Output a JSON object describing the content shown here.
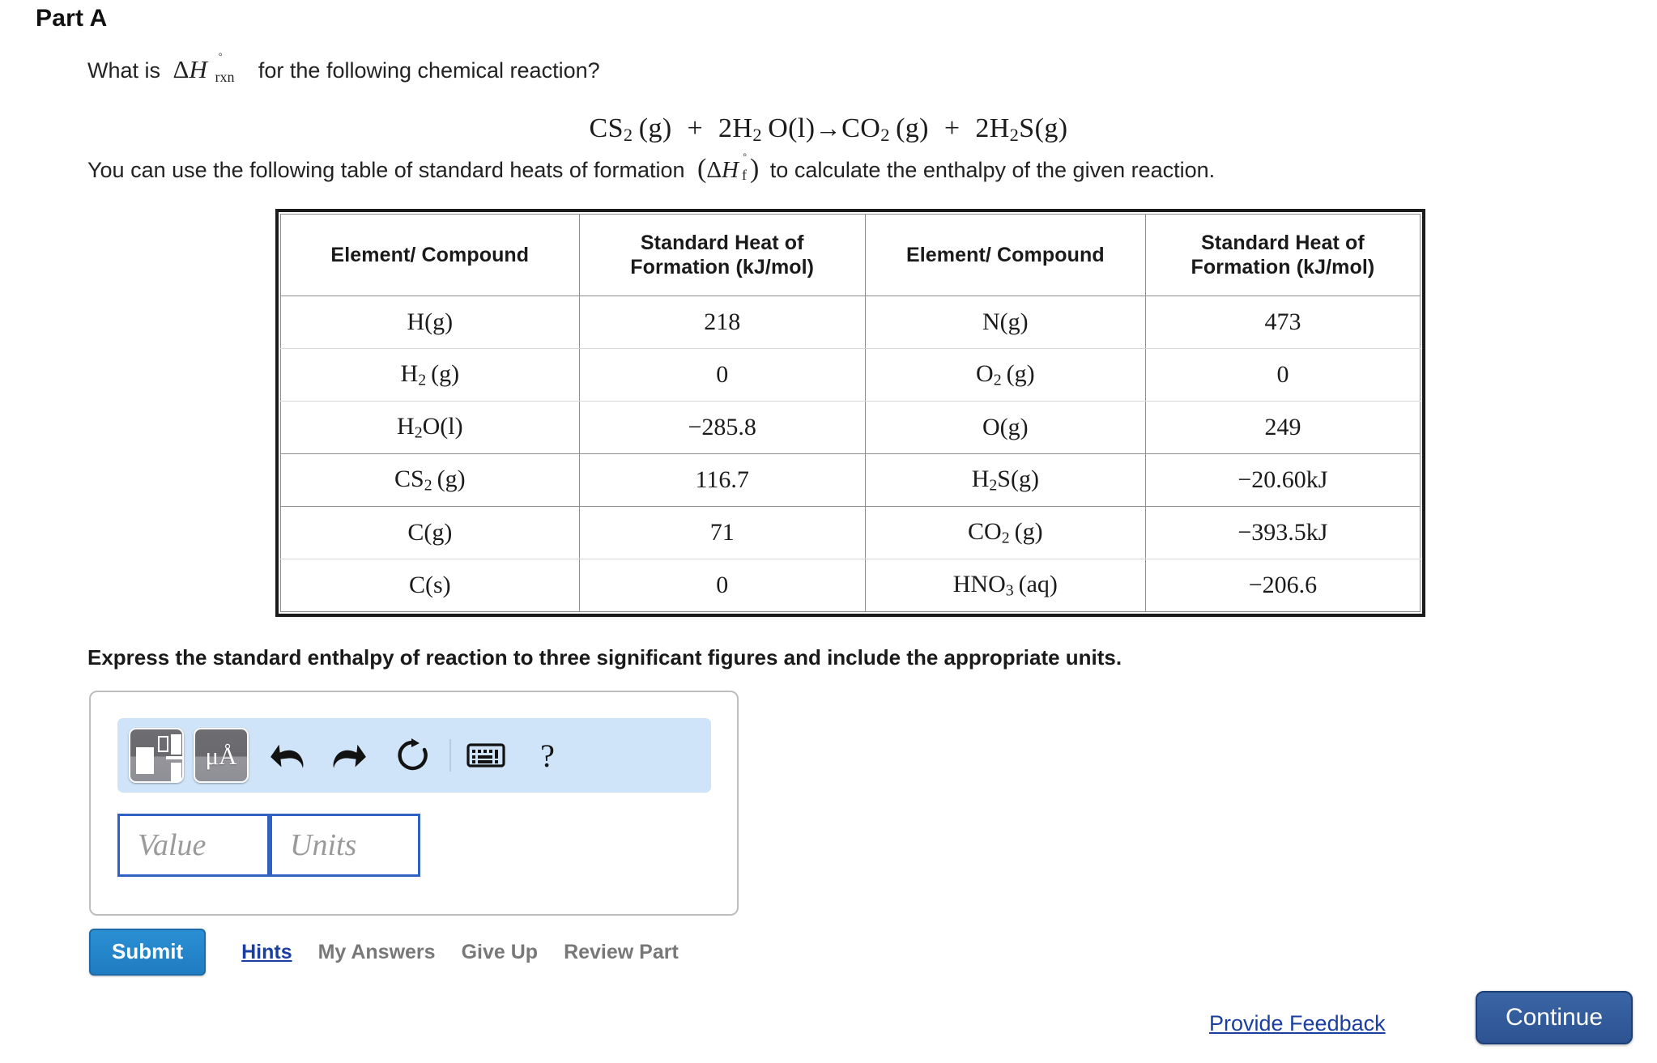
{
  "part": {
    "heading": "Part A"
  },
  "question": {
    "prefix": "What is",
    "symbol_delta": "Δ",
    "symbol_h": "H",
    "symbol_degree": "◦",
    "symbol_sub": "rxn",
    "suffix": "for the following chemical reaction?",
    "equation": "CS2 (g) + 2H2 O(l)→CO2 (g) + 2H2 S(g)",
    "equation_parts": {
      "reactant1": "CS",
      "reactant1_sub": "2",
      "reactant1_state": "(g)",
      "plus1": "+",
      "reactant2_coeff": "2H",
      "reactant2_sub": "2",
      "reactant2_el": "O",
      "reactant2_state": "(l)",
      "arrow": "→",
      "product1": "CO",
      "product1_sub": "2",
      "product1_state": "(g)",
      "plus2": "+",
      "product2_coeff": "2H",
      "product2_sub": "2",
      "product2_el": "S",
      "product2_state": "(g)"
    }
  },
  "intro": {
    "before": "You can use the following table of standard heats of formation",
    "paren_open": "(",
    "dh_delta": "Δ",
    "dh_h": "H",
    "dh_degree": "◦",
    "dh_sub": "f",
    "paren_close": ")",
    "after": "to calculate the enthalpy of the given reaction."
  },
  "table": {
    "headers": [
      "Element/ Compound",
      "Standard Heat of Formation (kJ/mol)",
      "Element/ Compound",
      "Standard Heat of Formation (kJ/mol)"
    ],
    "header_lines": [
      [
        "Element/ Compound"
      ],
      [
        "Standard Heat of",
        "Formation (kJ/mol)"
      ],
      [
        "Element/ Compound"
      ],
      [
        "Standard Heat of",
        "Formation (kJ/mol)"
      ]
    ],
    "rows": [
      {
        "left_species": "H(g)",
        "left_html": "H(g)",
        "left_value": "218",
        "right_species": "N(g)",
        "right_html": "N(g)",
        "right_value": "473"
      },
      {
        "left_species": "H2 (g)",
        "left_html": "H<sub>2</sub> (g)",
        "left_value": "0",
        "right_species": "O2 (g)",
        "right_html": "O<sub>2</sub> (g)",
        "right_value": "0"
      },
      {
        "left_species": "H2O(l)",
        "left_html": "H<sub>2</sub>O(l)",
        "left_value": "−285.8",
        "right_species": "O(g)",
        "right_html": "O(g)",
        "right_value": "249"
      },
      {
        "left_species": "CS2 (g)",
        "left_html": "CS<sub>2</sub> (g)",
        "left_value": "116.7",
        "right_species": "H2S(g)",
        "right_html": "H<sub>2</sub>S(g)",
        "right_value": "−20.60kJ"
      },
      {
        "left_species": "C(g)",
        "left_html": "C(g)",
        "left_value": "71",
        "right_species": "CO2 (g)",
        "right_html": "CO<sub>2</sub> (g)",
        "right_value": "−393.5kJ"
      },
      {
        "left_species": "C(s)",
        "left_html": "C(s)",
        "left_value": "0",
        "right_species": "HNO3 (aq)",
        "right_html": "HNO<sub>3</sub> (aq)",
        "right_value": "−206.6"
      }
    ]
  },
  "answer": {
    "instruction": "Express the standard enthalpy of reaction to three significant figures and include the appropriate units.",
    "toolbar": {
      "template_icon": "math-template-icon",
      "units_icon_label": "μÅ",
      "undo_icon": "undo-icon",
      "redo_icon": "redo-icon",
      "reset_icon": "reset-icon",
      "keyboard_icon": "keyboard-icon",
      "help_icon": "?"
    },
    "value_placeholder": "Value",
    "units_placeholder": "Units",
    "value_text": "",
    "units_text": ""
  },
  "actions": {
    "submit_label": "Submit",
    "hints_label": "Hints",
    "my_answers_label": "My Answers",
    "give_up_label": "Give Up",
    "review_part_label": "Review Part"
  },
  "footer": {
    "provide_feedback_label": "Provide Feedback",
    "continue_label": "Continue"
  },
  "colors": {
    "submit_blue": "#1f7cc0",
    "continue_navy": "#2d5392",
    "link_blue": "#1a3fa0",
    "toolbar_blue": "#cfe4f8",
    "input_border_blue": "#2f61c4",
    "disabled_gray": "#787878"
  }
}
